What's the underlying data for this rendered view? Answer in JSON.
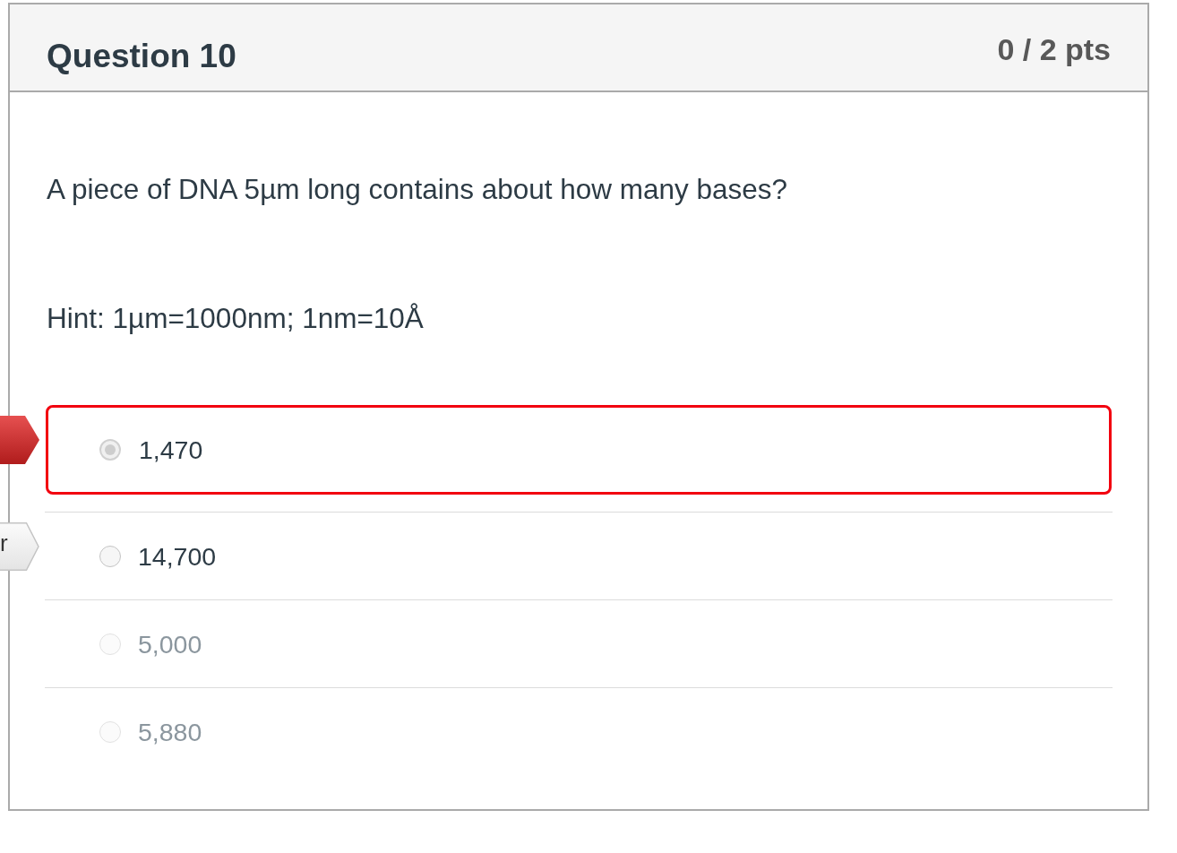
{
  "question": {
    "title": "Question 10",
    "points": "0 / 2 pts"
  },
  "body": {
    "text": "A piece of DNA 5µm long contains about how many bases?",
    "hint": "Hint: 1µm=1000nm; 1nm=10Å"
  },
  "answers": [
    {
      "text": "1,470",
      "selected": true,
      "dimmed": false,
      "flag": {
        "kind": "incorrect"
      }
    },
    {
      "text": "14,700",
      "selected": false,
      "dimmed": false,
      "flag": {
        "kind": "correct",
        "label": "r"
      }
    },
    {
      "text": "5,000",
      "selected": false,
      "dimmed": true
    },
    {
      "text": "5,880",
      "selected": false,
      "dimmed": true
    }
  ]
}
